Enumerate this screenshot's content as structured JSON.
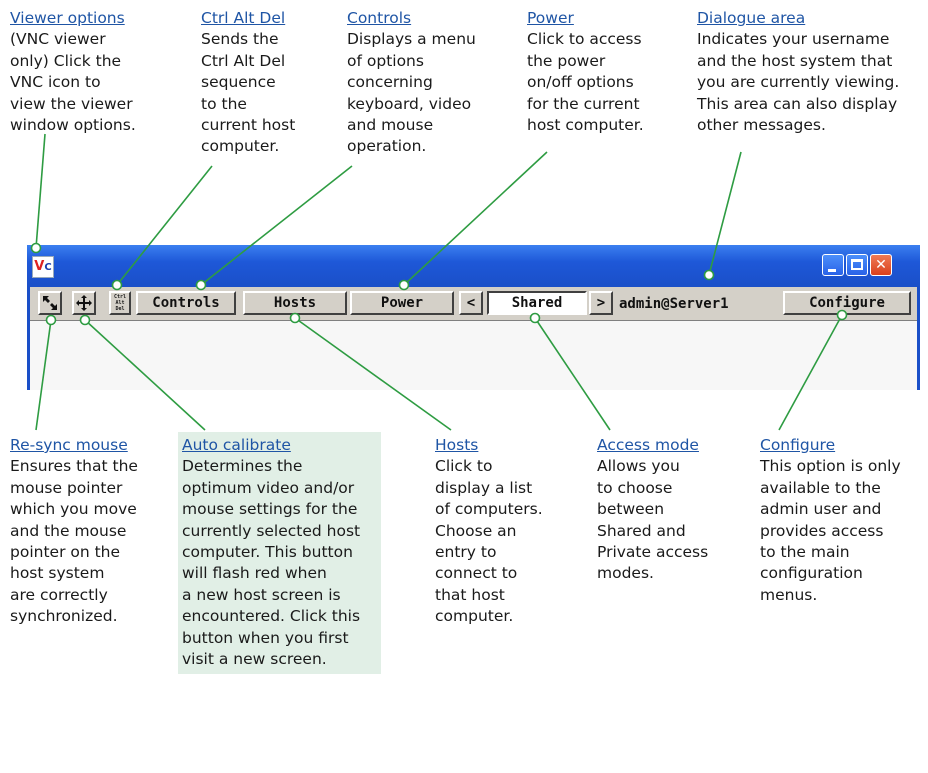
{
  "callouts": {
    "viewer_options": {
      "title": "Viewer options",
      "lines": [
        "(VNC viewer",
        "only) Click the",
        "VNC icon to",
        "view the viewer",
        "window options."
      ]
    },
    "ctrl_alt_del": {
      "title": "Ctrl Alt Del",
      "lines": [
        "Sends the",
        "Ctrl Alt Del",
        "sequence",
        "to the",
        "current host",
        "computer."
      ]
    },
    "controls": {
      "title": "Controls",
      "lines": [
        "Displays a menu",
        "of options",
        "concerning",
        "keyboard, video",
        "and mouse",
        "operation."
      ]
    },
    "power": {
      "title": "Power",
      "lines": [
        "Click to access",
        "the power",
        "on/off options",
        "for the current",
        "host computer."
      ]
    },
    "dialogue_area": {
      "title": "Dialogue area",
      "lines": [
        "Indicates your username",
        "and the host system that",
        "you are currently viewing.",
        "This area can also display",
        "other messages."
      ]
    },
    "resync_mouse": {
      "title": "Re-sync mouse",
      "lines": [
        "Ensures that the",
        "mouse pointer",
        "which you move",
        "and the mouse",
        "pointer on the",
        "host system",
        "are correctly",
        "synchronized."
      ]
    },
    "auto_calibrate": {
      "title": "Auto calibrate",
      "lines": [
        "Determines the",
        "optimum video and/or",
        "mouse settings for the",
        "currently selected host",
        "computer. This button",
        "will flash red when",
        "a new host screen is",
        "encountered. Click this",
        "button when you first",
        "visit a new screen."
      ]
    },
    "hosts": {
      "title": "Hosts",
      "lines": [
        "Click to",
        "display a list",
        "of computers.",
        "Choose an",
        "entry to",
        "connect to",
        "that host",
        "computer."
      ]
    },
    "access_mode": {
      "title": "Access mode",
      "lines": [
        "Allows you",
        "to choose",
        "between",
        "Shared and",
        "Private access",
        "modes."
      ]
    },
    "configure": {
      "title": "Configure",
      "lines": [
        "This option is only",
        "available to the",
        "admin user and",
        "provides access",
        "to the main",
        "configuration",
        "menus."
      ]
    }
  },
  "window": {
    "logo_v": "V",
    "logo_c": "C",
    "buttons": {
      "cad_lines": [
        "Ctrl",
        "Alt",
        "Del"
      ],
      "controls": "Controls",
      "hosts": "Hosts",
      "power": "Power",
      "prev": "<",
      "shared": "Shared",
      "next": ">",
      "status": "admin@Server1",
      "configure": "Configure"
    },
    "title_buttons": {
      "close": "✕"
    }
  },
  "colors": {
    "heading": "#1f55a5",
    "leader": "#2e9c42",
    "titlebar": "#1e58d8",
    "highlight_box": "#e1efe6"
  }
}
